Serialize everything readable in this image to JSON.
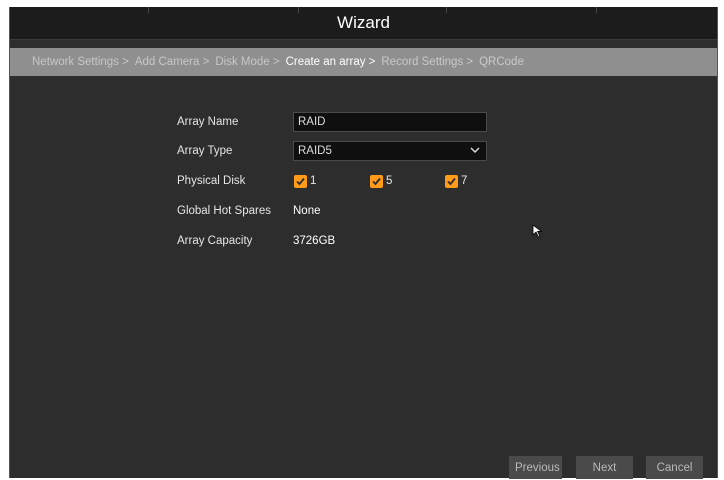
{
  "window": {
    "title": "Wizard"
  },
  "steps": [
    {
      "label": "Network Settings >",
      "state": "done"
    },
    {
      "label": "Add Camera >",
      "state": "done"
    },
    {
      "label": "Disk Mode >",
      "state": "done"
    },
    {
      "label": "Create an array >",
      "state": "current"
    },
    {
      "label": "Record Settings >",
      "state": "future"
    },
    {
      "label": "QRCode",
      "state": "future"
    }
  ],
  "form": {
    "array_name": {
      "label": "Array Name",
      "value": "RAID"
    },
    "array_type": {
      "label": "Array Type",
      "value": "RAID5"
    },
    "physical_disk": {
      "label": "Physical Disk",
      "disks": [
        {
          "label": "1",
          "checked": true
        },
        {
          "label": "5",
          "checked": true
        },
        {
          "label": "7",
          "checked": true
        }
      ]
    },
    "global_hot_spares": {
      "label": "Global Hot Spares",
      "value": "None"
    },
    "array_capacity": {
      "label": "Array Capacity",
      "value": "3726GB"
    }
  },
  "buttons": {
    "previous": "Previous",
    "next": "Next",
    "cancel": "Cancel"
  },
  "colors": {
    "checkbox": "#ff9a1a",
    "background": "#2d2d2d",
    "step_bar": "#8f8f8f"
  }
}
